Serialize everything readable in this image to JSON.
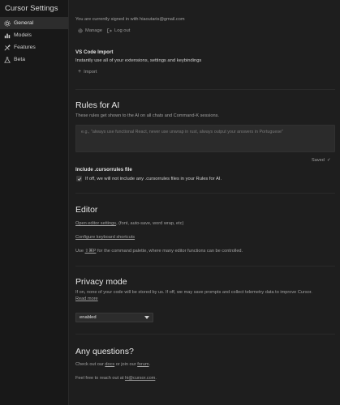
{
  "sidebar": {
    "title": "Cursor Settings",
    "items": [
      {
        "label": "General",
        "icon": "gear-icon",
        "active": true
      },
      {
        "label": "Models",
        "icon": "chart-icon",
        "active": false
      },
      {
        "label": "Features",
        "icon": "tools-icon",
        "active": false
      },
      {
        "label": "Beta",
        "icon": "flask-icon",
        "active": false
      }
    ]
  },
  "account": {
    "signed_in_text": "You are currently signed in with hiaoutaris@gmail.com",
    "manage_label": "Manage",
    "logout_label": "Log out"
  },
  "vscode_import": {
    "title": "VS Code Import",
    "description": "Instantly use all of your extensions, settings and keybindings",
    "import_label": "Import"
  },
  "rules_for_ai": {
    "title": "Rules for AI",
    "description": "These rules get shown to the AI on all chats and Command-K sessions.",
    "placeholder": "e.g., \"always use functional React, never use unwrap in rust, always output your answers in Portuguese\"",
    "status": "Saved",
    "include_title": "Include .cursorrules file",
    "include_description": "If off, we will not include any .cursorrules files in your Rules for AI.",
    "include_checked": true
  },
  "editor": {
    "title": "Editor",
    "line1_link": "Open editor settings",
    "line1_rest": ", (font, auto-save, word wrap, etc)",
    "line2_link": "Configure keyboard shortcuts",
    "line3_prefix": "Use ",
    "line3_key": "⇧⌘P",
    "line3_rest": " for the command palette, where many editor functions can be controlled."
  },
  "privacy": {
    "title": "Privacy mode",
    "description": "If on, none of your code will be stored by us. If off, we may save prompts and collect telemetry data to improve Cursor.",
    "read_more": "Read more",
    "selected": "enabled"
  },
  "questions": {
    "title": "Any questions?",
    "line1_prefix": "Check out our ",
    "docs": "docs",
    "line1_mid": " or join our ",
    "forum": "forum",
    "line2_prefix": "Feel free to reach out at ",
    "email": "hi@cursor.com"
  },
  "colors": {
    "background": "#1e1e1e",
    "sidebar": "#181818",
    "active_item": "#2d2d2d"
  }
}
